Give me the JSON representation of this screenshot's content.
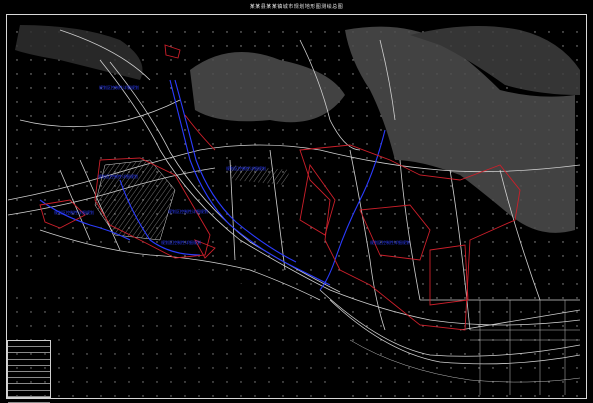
{
  "drawing": {
    "title": "某某县某某镇城市规划地形图测绘总图",
    "colors": {
      "background": "#000000",
      "terrain": "#5a5a5a",
      "lines": "#cfcfcf",
      "boundary_red": "#cc1f2a",
      "river_blue": "#2b3cff"
    }
  },
  "zone_labels": [
    {
      "text": "规划区控制性详细规划"
    },
    {
      "text": "规划区控制性详细规划"
    },
    {
      "text": "规划区控制性详细规划"
    },
    {
      "text": "规划区控制性详细规划"
    },
    {
      "text": "规划区控制性详细规划"
    },
    {
      "text": "规划区控制性详细规划"
    },
    {
      "text": "规划区控制性详细规划"
    }
  ]
}
